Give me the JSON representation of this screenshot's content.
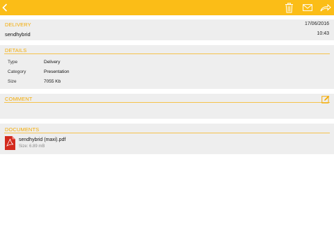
{
  "colors": {
    "accent": "#fbbd17",
    "section_title": "#f3ab05",
    "card_bg": "#eeeeee"
  },
  "toolbar": {
    "back_icon": "chevron-left-icon",
    "actions": [
      "trash-icon",
      "mail-icon",
      "share-forward-icon"
    ]
  },
  "delivery": {
    "title": "DELIVERY",
    "date": "17/06/2016",
    "name": "sendhybrid",
    "time": "10:43"
  },
  "details": {
    "title": "DETAILS",
    "rows": [
      {
        "label": "Type",
        "value": "Delivery"
      },
      {
        "label": "Category",
        "value": "Presentation"
      },
      {
        "label": "Size",
        "value": "7055 Kb"
      }
    ]
  },
  "comment": {
    "title": "COMMENT",
    "edit_icon": "edit-icon"
  },
  "documents": {
    "title": "DOCUMENTS",
    "items": [
      {
        "name": "sendhybrid (maxi).pdf",
        "size": "Size: 6.89 mB",
        "icon": "pdf-file-icon"
      }
    ]
  }
}
